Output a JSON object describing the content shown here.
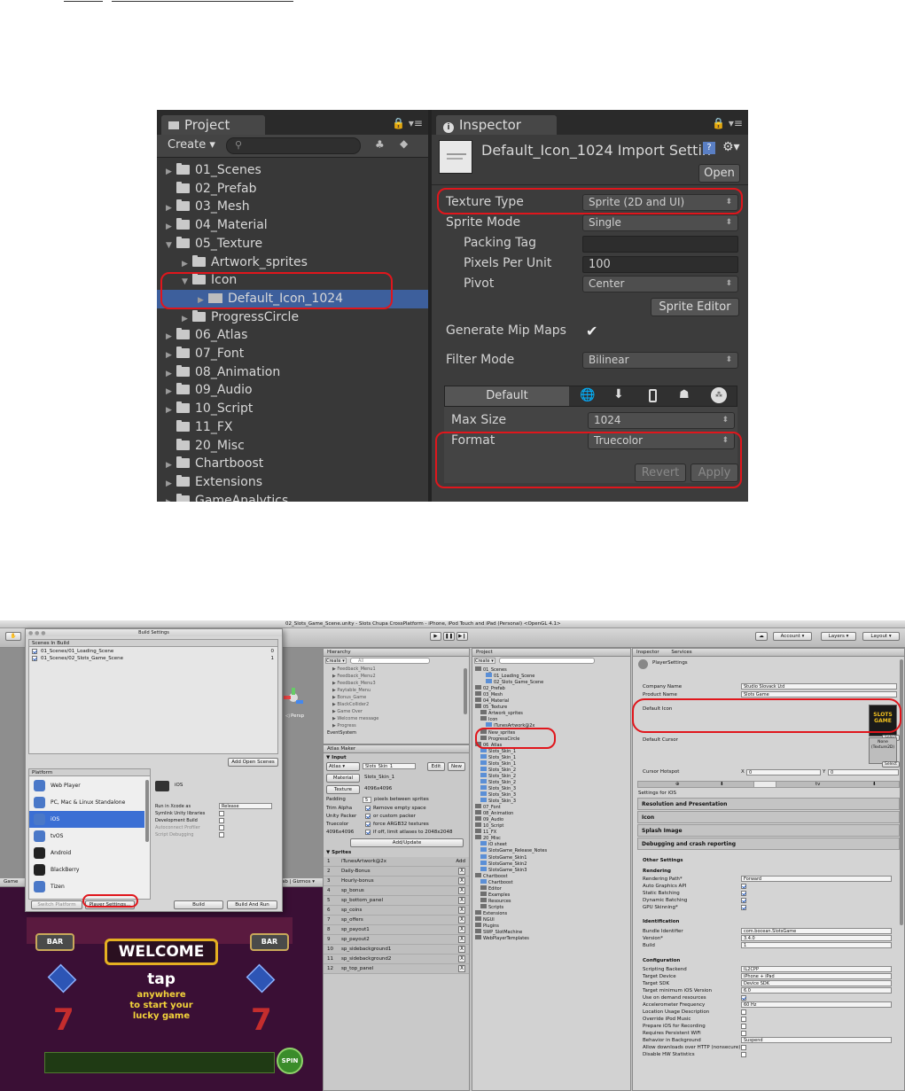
{
  "unity_project_panel": {
    "tab_title": "Project",
    "create_label": "Create ▾",
    "tree": [
      {
        "label": "01_Scenes",
        "expanded": false
      },
      {
        "label": "02_Prefab",
        "expanded": false
      },
      {
        "label": "03_Mesh",
        "expanded": false
      },
      {
        "label": "04_Material",
        "expanded": false
      },
      {
        "label": "05_Texture",
        "expanded": true
      },
      {
        "label": "Artwork_sprites",
        "expanded": false
      },
      {
        "label": "Icon",
        "expanded": true
      },
      {
        "label": "Default_Icon_1024",
        "selected": true
      },
      {
        "label": "ProgressCircle",
        "expanded": false
      },
      {
        "label": "06_Atlas",
        "expanded": false
      },
      {
        "label": "07_Font",
        "expanded": false
      },
      {
        "label": "08_Animation",
        "expanded": false
      },
      {
        "label": "09_Audio",
        "expanded": false
      },
      {
        "label": "10_Script",
        "expanded": false
      },
      {
        "label": "11_FX",
        "expanded": false
      },
      {
        "label": "20_Misc",
        "expanded": false
      },
      {
        "label": "Chartboost",
        "expanded": false
      },
      {
        "label": "Extensions",
        "expanded": false
      },
      {
        "label": "GameAnalytics",
        "expanded": false
      }
    ]
  },
  "unity_inspector_panel": {
    "tab_title": "Inspector",
    "asset_title": "Default_Icon_1024 Import Settin",
    "open_button": "Open",
    "rows": {
      "texture_type": {
        "label": "Texture Type",
        "value": "Sprite (2D and UI)"
      },
      "sprite_mode": {
        "label": "Sprite Mode",
        "value": "Single"
      },
      "packing_tag": {
        "label": "Packing Tag",
        "value": ""
      },
      "pixels_per_unit": {
        "label": "Pixels Per Unit",
        "value": "100"
      },
      "pivot": {
        "label": "Pivot",
        "value": "Center"
      },
      "generate_mip_maps": {
        "label": "Generate Mip Maps",
        "checked": true
      },
      "filter_mode": {
        "label": "Filter Mode",
        "value": "Bilinear"
      },
      "max_size": {
        "label": "Max Size",
        "value": "1024"
      },
      "format": {
        "label": "Format",
        "value": "Truecolor"
      }
    },
    "sprite_editor_button": "Sprite Editor",
    "platform_default_tab": "Default",
    "revert_button": "Revert",
    "apply_button": "Apply"
  },
  "bottom_window_title": "02_Slots_Game_Scene.unity - Slots Chupa CrossPlatform - iPhone, iPod Touch and iPad (Personal) <OpenGL 4.1>",
  "build_settings": {
    "title": "Build Settings",
    "scenes_header": "Scenes In Build",
    "scenes": [
      {
        "path": "01_Scenes/01_Loading_Scene",
        "index": "0"
      },
      {
        "path": "01_Scenes/02_Slots_Game_Scene",
        "index": "1"
      }
    ],
    "add_open_scenes": "Add Open Scenes",
    "platform_header": "Platform",
    "platforms": [
      "Web Player",
      "PC, Mac & Linux Standalone",
      "iOS",
      "tvOS",
      "Android",
      "BlackBerry",
      "Tizen"
    ],
    "selected_platform": "iOS",
    "options": [
      {
        "label": "Run in Xcode as",
        "value": "Release"
      },
      {
        "label": "Symlink Unity libraries",
        "value": ""
      },
      {
        "label": "Development Build",
        "value": ""
      },
      {
        "label": "Autoconnect Profiler",
        "value": ""
      },
      {
        "label": "Script Debugging",
        "value": ""
      }
    ],
    "switch_platform": "Switch Platform",
    "player_settings": "Player Settings...",
    "build": "Build",
    "build_and_run": "Build And Run"
  },
  "hierarchy": {
    "title": "Hierarchy",
    "create": "Create ▾",
    "search_placeholder": "All",
    "items": [
      "Feedback_Menu1",
      "Feedback_Menu2",
      "Feedback_Menu3",
      "Paytable_Menu",
      "Bonus_Game",
      "BlackCollider2",
      "Game Over",
      "Welcome message",
      "Progress",
      "EventSystem"
    ]
  },
  "atlas_maker": {
    "title": "Atlas Maker",
    "input_header": "Input",
    "atlas_label": "Atlas",
    "atlas_value": "Slots_Skin_1",
    "edit": "Edit",
    "new": "New",
    "material_label": "Material",
    "material_value": "Slots_Skin_1",
    "texture_label": "Texture",
    "texture_value": "4096x4096",
    "padding_label": "Padding",
    "padding_value": "5",
    "padding_suffix": "pixels between sprites",
    "options": [
      {
        "label": "Trim Alpha",
        "value": "Remove empty space"
      },
      {
        "label": "Unity Packer",
        "value": "or custom packer"
      },
      {
        "label": "Truecolor",
        "value": "force ARGB32 textures"
      },
      {
        "label": "4096x4096",
        "value": "if off, limit atlases to 2048x2048"
      }
    ],
    "add_update": "Add/Update",
    "sprites_header": "Sprites",
    "sprites": [
      "iTunesArtwork@2x",
      "Daily-Bonus",
      "Hourly-bonus",
      "sp_bonus",
      "sp_bottom_panel",
      "sp_coins",
      "sp_offers",
      "sp_payout1",
      "sp_payout2",
      "sp_sidebackground1",
      "sp_sidebackground2",
      "sp_top_panel"
    ],
    "add_label": "Add",
    "x_label": "X"
  },
  "project2": {
    "title": "Project",
    "create": "Create ▾",
    "tree": [
      "01_Scenes",
      "01_Loading_Scene",
      "02_Slots_Game_Scene",
      "02_Prefab",
      "03_Mesh",
      "04_Material",
      "05_Texture",
      "Artwork_sprites",
      "Icon",
      "iTunesArtwork@2x",
      "New_sprites",
      "ProgressCircle",
      "06_Atlas",
      "Slots_Skin_1",
      "Slots_Skin_1",
      "Slots_Skin_1",
      "Slots_Skin_2",
      "Slots_Skin_2",
      "Slots_Skin_2",
      "Slots_Skin_3",
      "Slots_Skin_3",
      "Slots_Skin_3",
      "07_Font",
      "08_Animation",
      "09_Audio",
      "10_Script",
      "11_FX",
      "20_Misc",
      "iO sheet",
      "SlotsGame_Release_Notes",
      "SlotsGame_Skin1",
      "SlotsGame_Skin2",
      "SlotsGame_Skin3",
      "Chartboost",
      "Chartboost",
      "Editor",
      "Examples",
      "Resources",
      "Scripts",
      "Extensions",
      "NGUI",
      "Plugins",
      "SWP_SlotMachine",
      "WebPlayerTemplates"
    ]
  },
  "inspector2": {
    "tab": "Inspector",
    "services_tab": "Services",
    "title": "PlayerSettings",
    "company_label": "Company Name",
    "company_value": "Studio Slovack Ltd",
    "product_label": "Product Name",
    "product_value": "Slots Game",
    "default_icon_label": "Default Icon",
    "icon_text": "SLOTS GAME",
    "select": "Select",
    "default_cursor_label": "Default Cursor",
    "cursor_none": "None (Texture2D)",
    "cursor_hotspot_label": "Cursor Hotspot",
    "hotspot_x": "0",
    "hotspot_y": "0",
    "settings_for": "Settings for iOS",
    "sections": [
      "Resolution and Presentation",
      "Icon",
      "Splash Image",
      "Debugging and crash reporting"
    ],
    "other_settings": "Other Settings",
    "rendering": "Rendering",
    "rendering_rows": [
      {
        "label": "Rendering Path*",
        "value": "Forward"
      },
      {
        "label": "Auto Graphics API",
        "value": ""
      },
      {
        "label": "Static Batching",
        "value": ""
      },
      {
        "label": "Dynamic Batching",
        "value": ""
      },
      {
        "label": "GPU Skinning*",
        "value": ""
      }
    ],
    "identification": "Identification",
    "bundle_label": "Bundle Identifier",
    "bundle_value": "com.bocean.SlotsGame",
    "version_label": "Version*",
    "version_value": "3.4.0",
    "build_label": "Build",
    "build_value": "1",
    "configuration": "Configuration",
    "config_rows": [
      {
        "label": "Scripting Backend",
        "value": "IL2CPP"
      },
      {
        "label": "Target Device",
        "value": "iPhone + iPad"
      },
      {
        "label": "Target SDK",
        "value": "Device SDK"
      },
      {
        "label": "Target minimum iOS Version",
        "value": "6.0"
      },
      {
        "label": "Use on demand resources",
        "value": ""
      },
      {
        "label": "Accelerometer Frequency",
        "value": "60 Hz"
      },
      {
        "label": "Location Usage Description",
        "value": ""
      },
      {
        "label": "Override iPod Music",
        "value": ""
      },
      {
        "label": "Prepare iOS for Recording",
        "value": ""
      },
      {
        "label": "Requires Persistent WiFi",
        "value": ""
      },
      {
        "label": "Behavior in Background",
        "value": "Suspend"
      },
      {
        "label": "Allow downloads over HTTP (nonsecure)",
        "value": ""
      },
      {
        "label": "Disable HW Statistics",
        "value": ""
      }
    ]
  },
  "game_view": {
    "welcome": "WELCOME",
    "tap": "tap",
    "line1": "anywhere",
    "line2": "to start your",
    "line3": "lucky game",
    "spin": "SPIN",
    "bar": "BAR",
    "tab": "Game"
  },
  "toolbar2": {
    "account": "Account",
    "layers": "Layers",
    "layout": "Layout"
  },
  "colors": {
    "annotation_red": "#e0161c",
    "unity_dark": "#383838",
    "selection_blue": "#3d5f9c"
  }
}
